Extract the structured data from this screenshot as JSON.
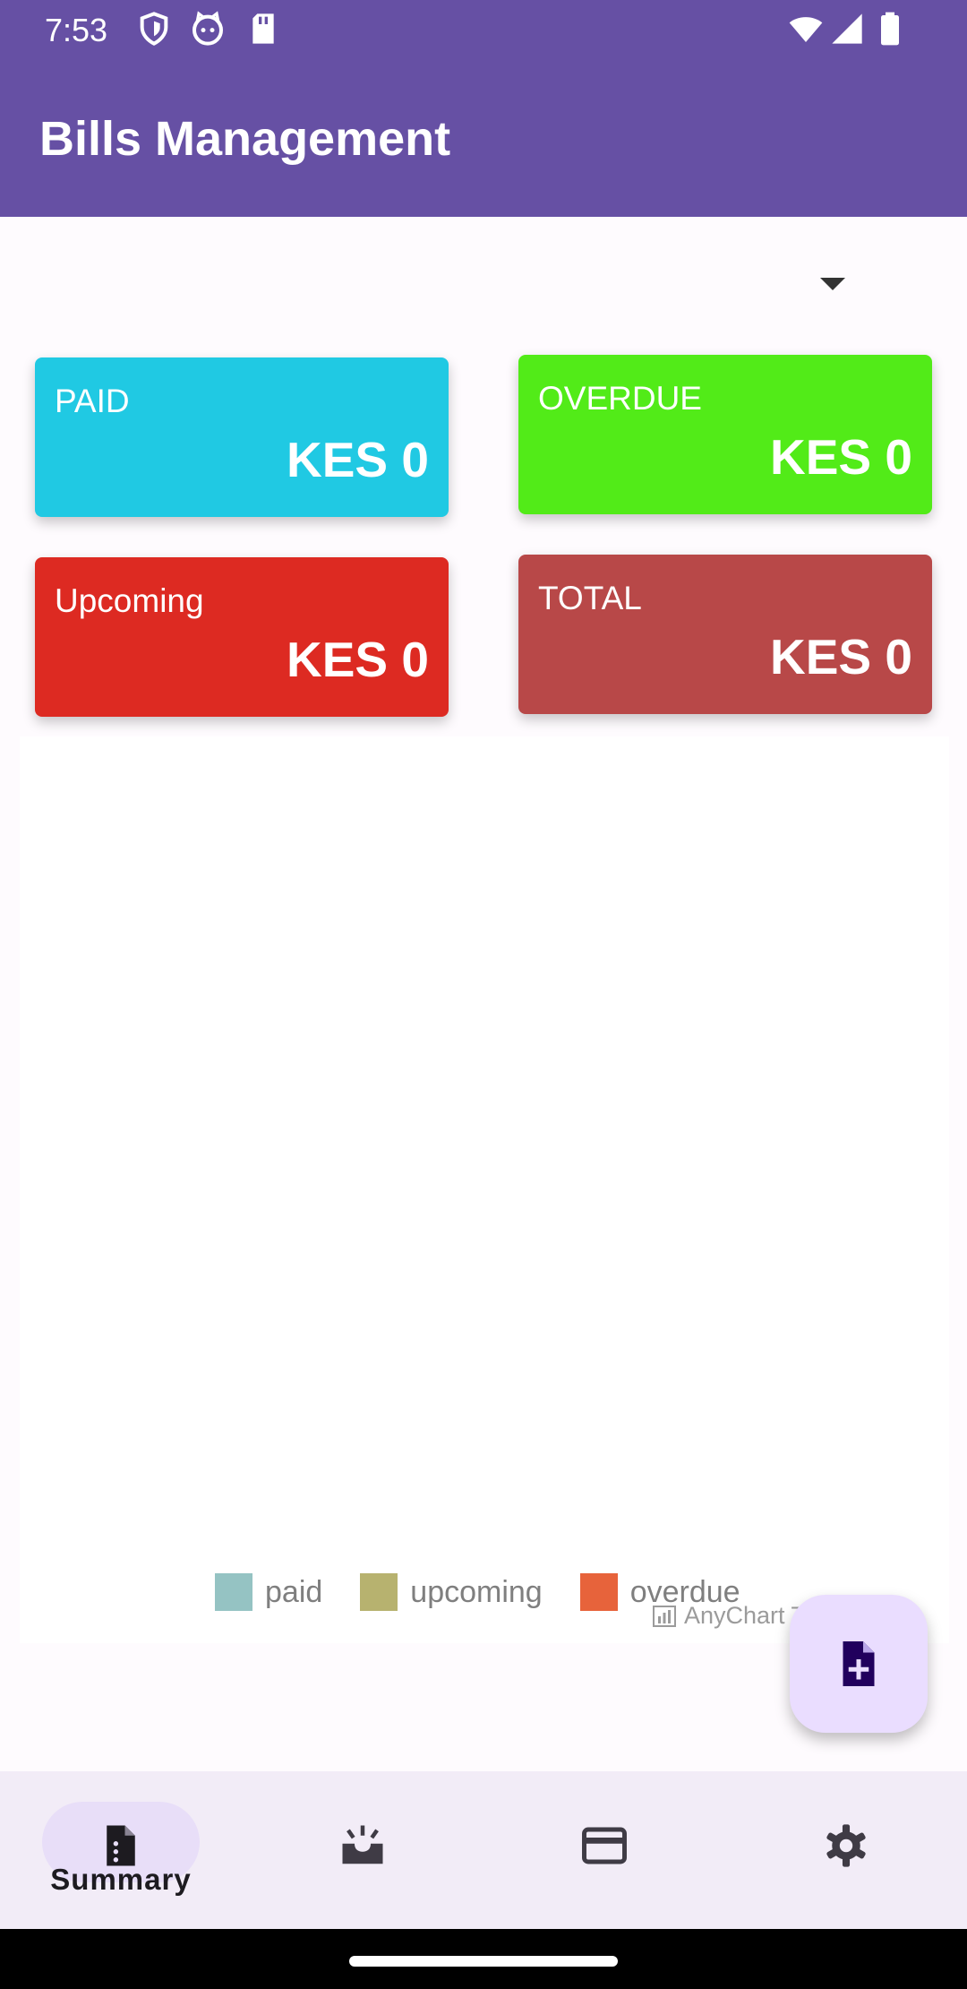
{
  "status_bar": {
    "time": "7:53",
    "icons": [
      "shield-icon",
      "cat-icon",
      "sd-card-icon",
      "wifi-icon",
      "signal-icon",
      "battery-icon"
    ]
  },
  "app_bar": {
    "title": "Bills Management",
    "color": "#6650a4"
  },
  "filter": {
    "selected": "",
    "icon": "dropdown-arrow-icon"
  },
  "cards": [
    {
      "label": "PAID",
      "value": "KES 0",
      "color": "#20c9e3"
    },
    {
      "label": "OVERDUE",
      "value": "KES 0",
      "color": "#52eb18"
    },
    {
      "label": "Upcoming",
      "value": "KES 0",
      "color": "#dd2a22"
    },
    {
      "label": "TOTAL",
      "value": "KES 0",
      "color": "#b84848"
    }
  ],
  "chart": {
    "legend": [
      {
        "label": "paid",
        "color": "#95c3c3"
      },
      {
        "label": "upcoming",
        "color": "#b7b26f"
      },
      {
        "label": "overdue",
        "color": "#e7633b"
      }
    ],
    "credits": "AnyChart T"
  },
  "fab": {
    "icon": "add-document-icon"
  },
  "bottom_nav": {
    "items": [
      {
        "label": "Summary",
        "icon": "summary-icon",
        "active": true
      },
      {
        "label": "",
        "icon": "inbox-icon",
        "active": false
      },
      {
        "label": "",
        "icon": "credit-card-icon",
        "active": false
      },
      {
        "label": "",
        "icon": "gear-icon",
        "active": false
      }
    ]
  }
}
